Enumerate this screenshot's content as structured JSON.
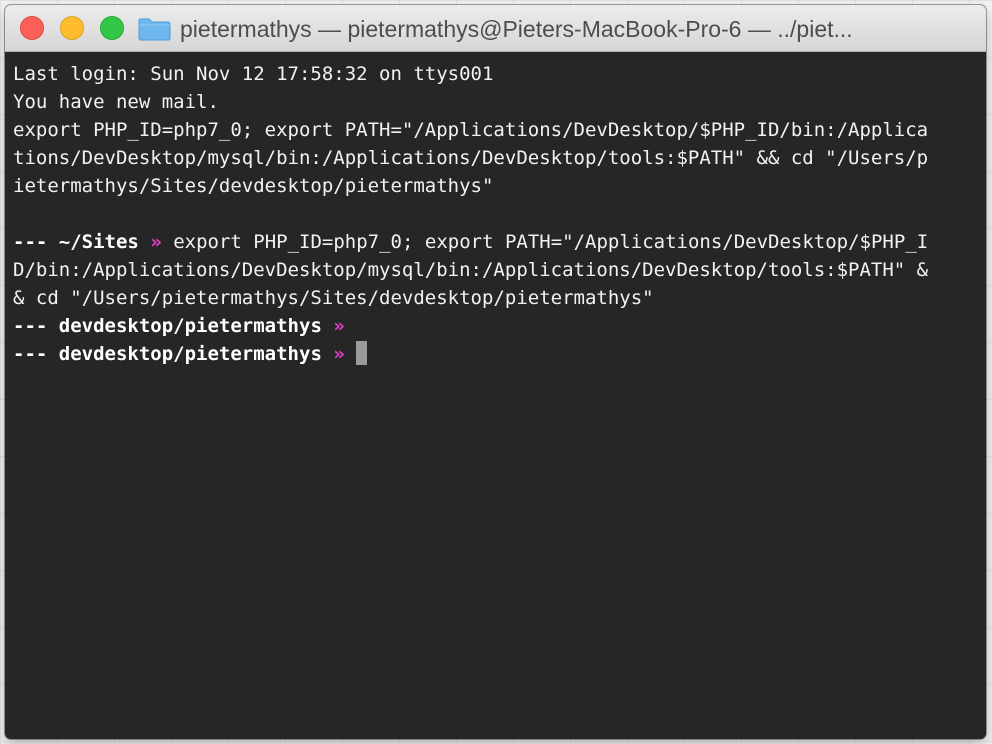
{
  "window": {
    "title": "pietermathys — pietermathys@Pieters-MacBook-Pro-6 — ../piet..."
  },
  "terminal": {
    "lines": [
      "Last login: Sun Nov 12 17:58:32 on ttys001",
      "You have new mail.",
      "export PHP_ID=php7_0; export PATH=\"/Applications/DevDesktop/$PHP_ID/bin:/Applica",
      "tions/DevDesktop/mysql/bin:/Applications/DevDesktop/tools:$PATH\" && cd \"/Users/p",
      "ietermathys/Sites/devdesktop/pietermathys\""
    ],
    "prompt1": {
      "dashes": "---",
      "path": "~/Sites",
      "arrow": "»",
      "command_lines": [
        "export PHP_ID=php7_0; export PATH=\"/Applications/DevDesktop/$PHP_I",
        "D/bin:/Applications/DevDesktop/mysql/bin:/Applications/DevDesktop/tools:$PATH\" &",
        "& cd \"/Users/pietermathys/Sites/devdesktop/pietermathys\""
      ]
    },
    "prompt2": {
      "dashes": "---",
      "path": "devdesktop/pietermathys",
      "arrow": "»"
    },
    "prompt3": {
      "dashes": "---",
      "path": "devdesktop/pietermathys",
      "arrow": "»"
    }
  },
  "colors": {
    "terminal_bg": "#262626",
    "text": "#f2f2f2",
    "prompt_arrow": "#e040c8",
    "close": "#fc5f57",
    "minimize": "#fdbc2e",
    "zoom": "#33c748"
  },
  "icons": {
    "folder": "folder-icon"
  }
}
